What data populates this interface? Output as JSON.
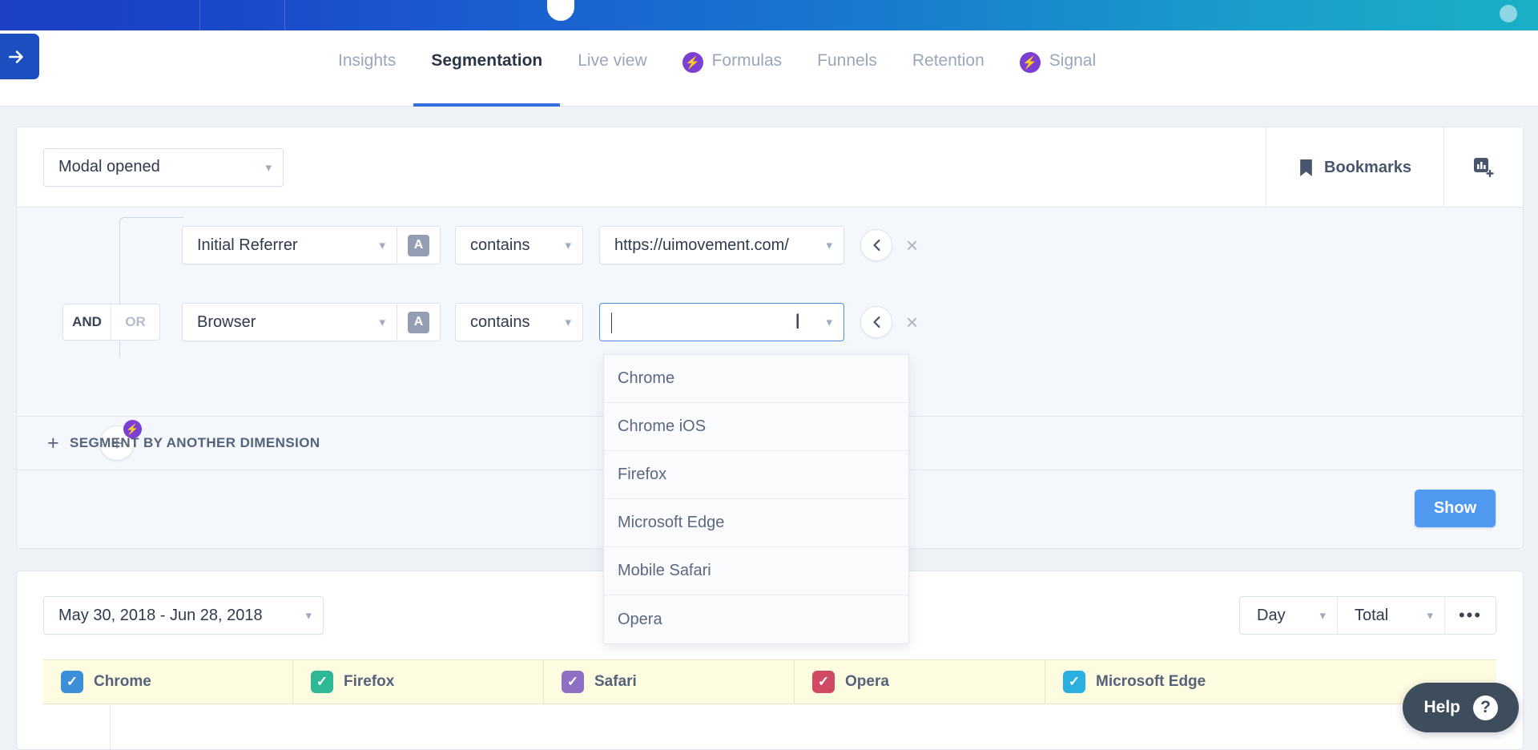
{
  "topbar": {
    "accent_start": "#1c3fc4",
    "accent_end": "#19b0c7"
  },
  "nav": {
    "sidebar_toggle_icon": "arrow-right-icon",
    "items": [
      {
        "label": "Insights",
        "active": false,
        "bolt": false
      },
      {
        "label": "Segmentation",
        "active": true,
        "bolt": false
      },
      {
        "label": "Live view",
        "active": false,
        "bolt": false
      },
      {
        "label": "Formulas",
        "active": false,
        "bolt": true
      },
      {
        "label": "Funnels",
        "active": false,
        "bolt": false
      },
      {
        "label": "Retention",
        "active": false,
        "bolt": false
      },
      {
        "label": "Signal",
        "active": false,
        "bolt": true
      }
    ],
    "bolt_color": "#7b3fd4",
    "active_underline_color": "#2f6fe0"
  },
  "query": {
    "event": "Modal opened",
    "bookmarks_label": "Bookmarks",
    "bookmark_icon": "bookmark-icon",
    "add_chart_icon": "add-chart-icon",
    "logic": {
      "and": "AND",
      "or": "OR",
      "selected": "AND"
    },
    "filters": [
      {
        "property": "Initial Referrer",
        "type_badge": "A",
        "operator": "contains",
        "value": "https://uimovement.com/",
        "collapse_icon": "chevron-left-icon",
        "remove_icon": "close-icon"
      },
      {
        "property": "Browser",
        "type_badge": "A",
        "operator": "contains",
        "value": "",
        "placeholder": "",
        "collapse_icon": "chevron-left-icon",
        "remove_icon": "close-icon"
      }
    ],
    "add_filter_icon": "plus-icon",
    "segment_by_label": "SEGMENT BY ANOTHER DIMENSION",
    "show_label": "Show",
    "show_color": "#4f9af0"
  },
  "dropdown": {
    "open": true,
    "options": [
      "Chrome",
      "Chrome iOS",
      "Firefox",
      "Microsoft Edge",
      "Mobile Safari",
      "Opera"
    ]
  },
  "results": {
    "date_range": "May 30, 2018 - Jun 28, 2018",
    "granularity": "Day",
    "metric": "Total",
    "more_options": "•••",
    "legend": [
      {
        "label": "Chrome",
        "color": "#3d8fd8",
        "checked": true
      },
      {
        "label": "Firefox",
        "color": "#2fb896",
        "checked": true
      },
      {
        "label": "Safari",
        "color": "#8e6fc4",
        "checked": true
      },
      {
        "label": "Opera",
        "color": "#d14a63",
        "checked": true
      },
      {
        "label": "Microsoft Edge",
        "color": "#29b0e0",
        "checked": true
      }
    ],
    "legend_bg": "#fdfbe0"
  },
  "help": {
    "label": "Help",
    "icon": "question-mark-icon"
  }
}
